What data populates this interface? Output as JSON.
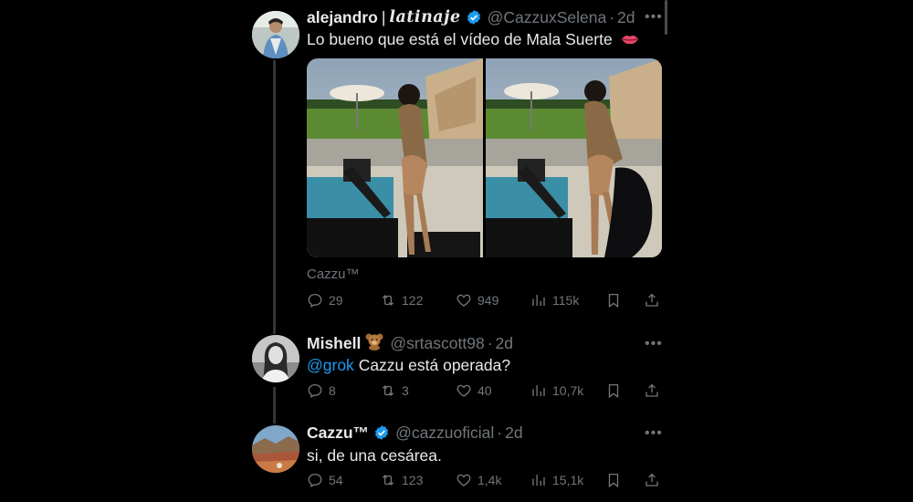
{
  "tweets": [
    {
      "name_main": "alejandro",
      "name_divider": "|",
      "name_brand": "latinaje",
      "verified": true,
      "handle": "@CazzuxSelena",
      "time": "2d",
      "text": "Lo bueno que está el vídeo de Mala Suerte",
      "text_emoji": "lips-emoji",
      "media_caption": "Cazzu™",
      "stats": {
        "replies": "29",
        "reposts": "122",
        "likes": "949",
        "views": "115k"
      }
    },
    {
      "name_main": "Mishell",
      "name_emoji": "teddy-bear-emoji",
      "handle": "@srtascott98",
      "time": "2d",
      "mention": "@grok",
      "text": "Cazzu está operada?",
      "stats": {
        "replies": "8",
        "reposts": "3",
        "likes": "40",
        "views": "10,7k"
      }
    },
    {
      "name_main": "Cazzu™",
      "verified": true,
      "handle": "@cazzuoficial",
      "time": "2d",
      "text": "si, de una cesárea.",
      "stats": {
        "replies": "54",
        "reposts": "123",
        "likes": "1,4k",
        "views": "15,1k"
      }
    }
  ],
  "colors": {
    "background": "#000000",
    "text": "#e7e9ea",
    "muted": "#71767b",
    "accent": "#1d9bf0"
  }
}
